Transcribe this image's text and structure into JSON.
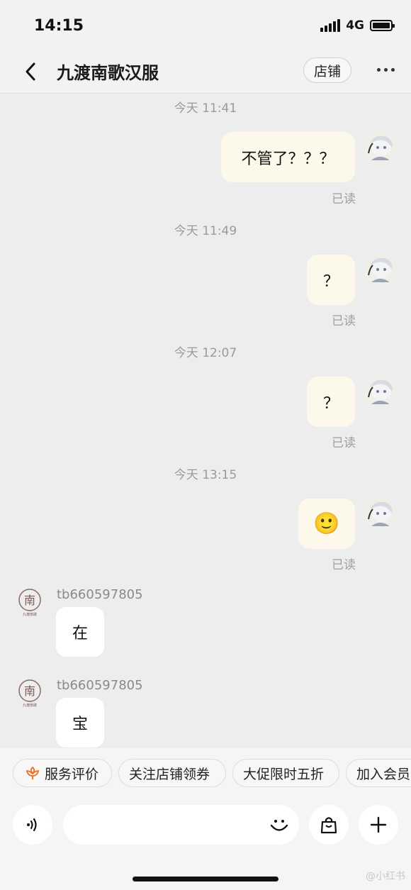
{
  "status_bar": {
    "time": "14:15",
    "network": "4G"
  },
  "header": {
    "title": "九渡南歌汉服",
    "store_button": "店铺"
  },
  "messages": [
    {
      "timestamp": "今天 11:41",
      "text": "不管了？？？",
      "read": "已读"
    },
    {
      "timestamp": "今天 11:49",
      "text": "？",
      "read": "已读"
    },
    {
      "timestamp": "今天 12:07",
      "text": "？",
      "read": "已读"
    },
    {
      "timestamp": "今天 13:15",
      "text": "🙂",
      "read": "已读"
    }
  ],
  "incoming": [
    {
      "sender": "tb660597805",
      "text": "在"
    },
    {
      "sender": "tb660597805",
      "text": "宝"
    }
  ],
  "shop_logo_text": "九渡南歌",
  "quick_replies": [
    "服务评价",
    "关注店铺领券",
    "大促限时五折",
    "加入会员"
  ],
  "watermark": "@小红书"
}
